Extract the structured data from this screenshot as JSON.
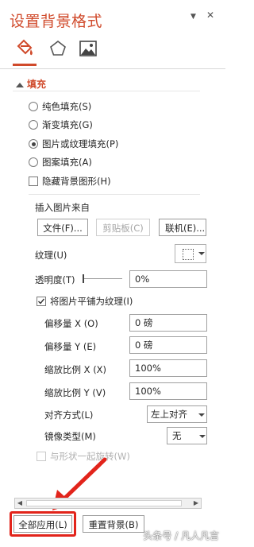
{
  "pane": {
    "title": "设置背景格式",
    "pin_glyph": "▼",
    "close_glyph": "✕",
    "tabs": [
      {
        "icon": "fill-bucket-icon"
      },
      {
        "icon": "pentagon-icon"
      },
      {
        "icon": "picture-icon"
      }
    ]
  },
  "fill": {
    "section_label": "填充",
    "options": [
      {
        "label": "纯色填充(S)",
        "selected": false
      },
      {
        "label": "渐变填充(G)",
        "selected": false
      },
      {
        "label": "图片或纹理填充(P)",
        "selected": true
      },
      {
        "label": "图案填充(A)",
        "selected": false
      }
    ],
    "hide_bg_label": "隐藏背景图形(H)",
    "insert_from_label": "插入图片来自",
    "file_button": "文件(F)...",
    "clipboard_button": "剪贴板(C)",
    "online_button": "联机(E)...",
    "texture_label": "纹理(U)",
    "transparency_label": "透明度(T)",
    "transparency_value": "0%",
    "transparency_level": 0,
    "tile_label": "将图片平铺为纹理(I)",
    "offset_x_label": "偏移量 X (O)",
    "offset_x_value": "0 磅",
    "offset_y_label": "偏移量 Y (E)",
    "offset_y_value": "0 磅",
    "scale_x_label": "缩放比例 X (X)",
    "scale_x_value": "100%",
    "scale_y_label": "缩放比例 Y (V)",
    "scale_y_value": "100%",
    "align_label": "对齐方式(L)",
    "align_value": "左上对齐",
    "mirror_label": "镜像类型(M)",
    "mirror_value": "无",
    "rotate_label": "与形状一起旋转(W)"
  },
  "footer": {
    "apply_all_button": "全部应用(L)",
    "reset_button": "重置背景(B)"
  },
  "watermark": "头条号 / 凡人凡言",
  "colors": {
    "accent": "#d04a2b",
    "highlight": "#e2241b"
  }
}
